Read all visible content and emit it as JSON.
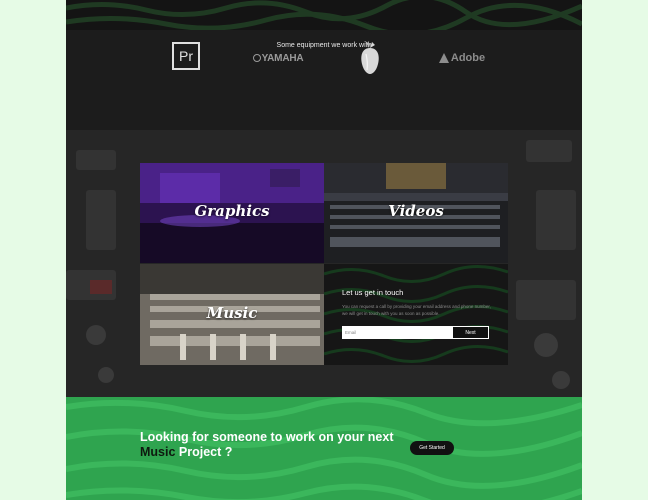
{
  "equipment": {
    "title": "Some equipment we work with",
    "logos": [
      {
        "name": "premiere-pro",
        "text": "Pr"
      },
      {
        "name": "yamaha",
        "text": "YAMAHA"
      },
      {
        "name": "fl-studio",
        "text": ""
      },
      {
        "name": "adobe",
        "text": "Adobe"
      }
    ]
  },
  "tiles": {
    "graphics": "Graphics",
    "videos": "Videos",
    "music": "Music"
  },
  "contact": {
    "title": "Let us get in touch",
    "description": "You can request a call by providing your email address and phone number, we will get in touch with you as soon as possible.",
    "email_placeholder": "Email",
    "next_label": "Next"
  },
  "cta": {
    "line1": "Looking for someone to work on your next",
    "highlight": "Music",
    "line2_rest": " Project ?",
    "button_label": "Get Started"
  },
  "colors": {
    "brand_green": "#2fa44f",
    "dark": "#1b1b1b",
    "page_bg": "#e6fbe6"
  }
}
